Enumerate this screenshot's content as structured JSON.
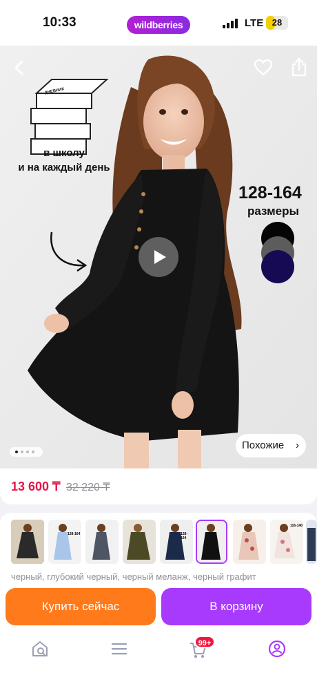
{
  "status_bar": {
    "time": "10:33",
    "network": "LTE",
    "battery": "28"
  },
  "header": {
    "logo": "wildberries"
  },
  "hero": {
    "promo_line1": "в школу",
    "promo_line2": "и на каждый день",
    "book_label": "ДНЕВНИК",
    "size_range": "128-164",
    "size_word": "размеры",
    "swatch_colors": [
      "#050505",
      "#5c5c5c",
      "#160a55"
    ],
    "similar_label": "Похожие",
    "gallery_dots": 4,
    "gallery_active_index": 0
  },
  "price": {
    "current": "13 600 ₸",
    "old": "32 220 ₸"
  },
  "variants": {
    "selected_index": 5,
    "thumb_labels": [
      "128-164",
      "128-164",
      "",
      "128-164",
      "128-164",
      "128-164",
      "",
      "116-140"
    ],
    "colors_text": "черный, глубокий черный, черный меланж, черный графит"
  },
  "actions": {
    "buy_now": "Купить сейчас",
    "to_cart": "В корзину"
  },
  "tabbar": {
    "cart_badge": "99+",
    "items": [
      "home-search-icon",
      "menu-icon",
      "cart-icon",
      "profile-icon"
    ]
  }
}
